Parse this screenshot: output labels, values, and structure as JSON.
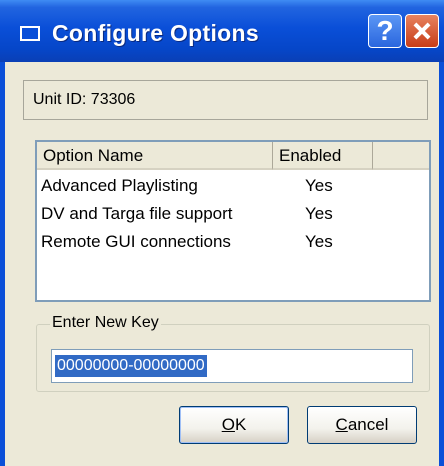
{
  "window": {
    "title": "Configure Options"
  },
  "titlebar": {
    "help_glyph": "?",
    "close_icon": "close-icon",
    "window_icon": "window-icon"
  },
  "unit": {
    "label": "Unit ID: 73306"
  },
  "options_list": {
    "columns": [
      "Option Name",
      "Enabled"
    ],
    "rows": [
      {
        "name": "Advanced Playlisting",
        "enabled": "Yes"
      },
      {
        "name": "DV and Targa file support",
        "enabled": "Yes"
      },
      {
        "name": "Remote GUI connections",
        "enabled": "Yes"
      }
    ]
  },
  "key": {
    "group_label": "Enter New Key",
    "value": "00000000-00000000"
  },
  "buttons": {
    "ok_accel": "O",
    "ok_rest": "K",
    "cancel_accel": "C",
    "cancel_rest": "ancel"
  },
  "colors": {
    "title_bar": "#0a4fd8",
    "dialog_bg": "#ece9d8",
    "selection": "#316ac5"
  }
}
